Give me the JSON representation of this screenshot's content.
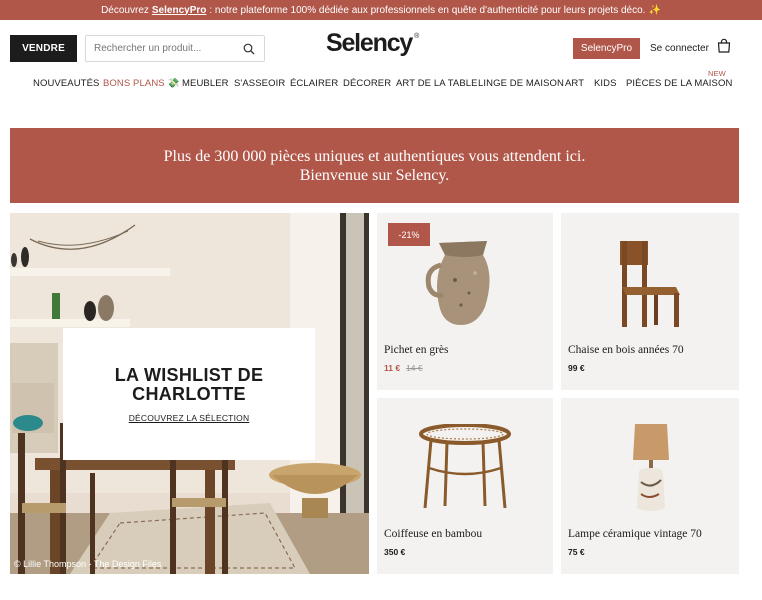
{
  "promo_bar": {
    "prefix": "Découvrez",
    "brand": "SelencyPro",
    "message": ": notre plateforme 100% dédiée aux professionnels en quête d'authenticité pour leurs projets déco.",
    "emoji": "✨"
  },
  "header": {
    "sell_label": "VENDRE",
    "search_placeholder": "Rechercher un produit...",
    "logo": "Selency",
    "logo_mark": "®",
    "pro_label": "SelencyPro",
    "login_label": "Se connecter"
  },
  "nav": {
    "items": [
      "NOUVEAUTÉS",
      "BONS PLANS 💸",
      "MEUBLER",
      "S'ASSEOIR",
      "ÉCLAIRER",
      "DÉCORER",
      "ART DE LA TABLE",
      "LINGE DE MAISON",
      "ART",
      "KIDS",
      "PIÈCES DE LA MAISON"
    ],
    "new_badge": "NEW"
  },
  "banner": {
    "line1": "Plus de 300 000 pièces uniques et authentiques vous attendent ici.",
    "line2": "Bienvenue sur Selency."
  },
  "hero": {
    "title_line1": "LA WISHLIST DE",
    "title_line2": "CHARLOTTE",
    "link": "DÉCOUVREZ LA SÉLECTION",
    "credit": "© Lillie Thompson - The Design Files"
  },
  "products": [
    {
      "name": "Pichet en grès",
      "price": "11 €",
      "old_price": "14 €",
      "badge": "-21%"
    },
    {
      "name": "Chaise en bois années 70",
      "price": "99 €"
    },
    {
      "name": "Coiffeuse en bambou",
      "price": "350 €"
    },
    {
      "name": "Lampe céramique vintage 70",
      "price": "75 €"
    }
  ],
  "colors": {
    "accent": "#b0574a",
    "dark": "#1c1c1c",
    "card_bg": "#f3f2f0"
  }
}
